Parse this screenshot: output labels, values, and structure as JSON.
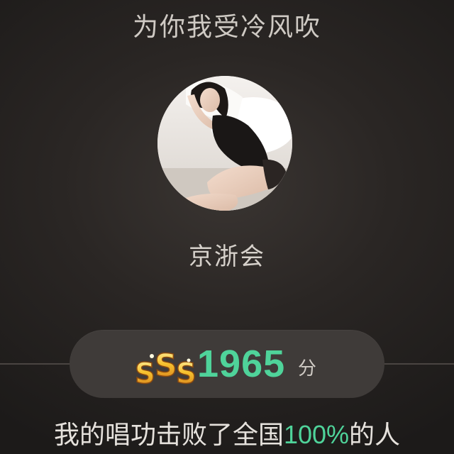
{
  "song": {
    "title": "为你我受冷风吹"
  },
  "singer": {
    "name": "京浙会",
    "avatar_icon": "user-avatar-photo"
  },
  "score": {
    "grade": "SSS",
    "value": "1965",
    "unit": "分",
    "grade_icon": "sss-grade-badge-icon"
  },
  "result": {
    "prefix": "我的唱功击败了全国",
    "percent": "100%",
    "suffix": "的人"
  },
  "colors": {
    "accent": "#4fd39a",
    "grade_gold": "#f2b32a",
    "pill_bg": "#3f3b39"
  }
}
